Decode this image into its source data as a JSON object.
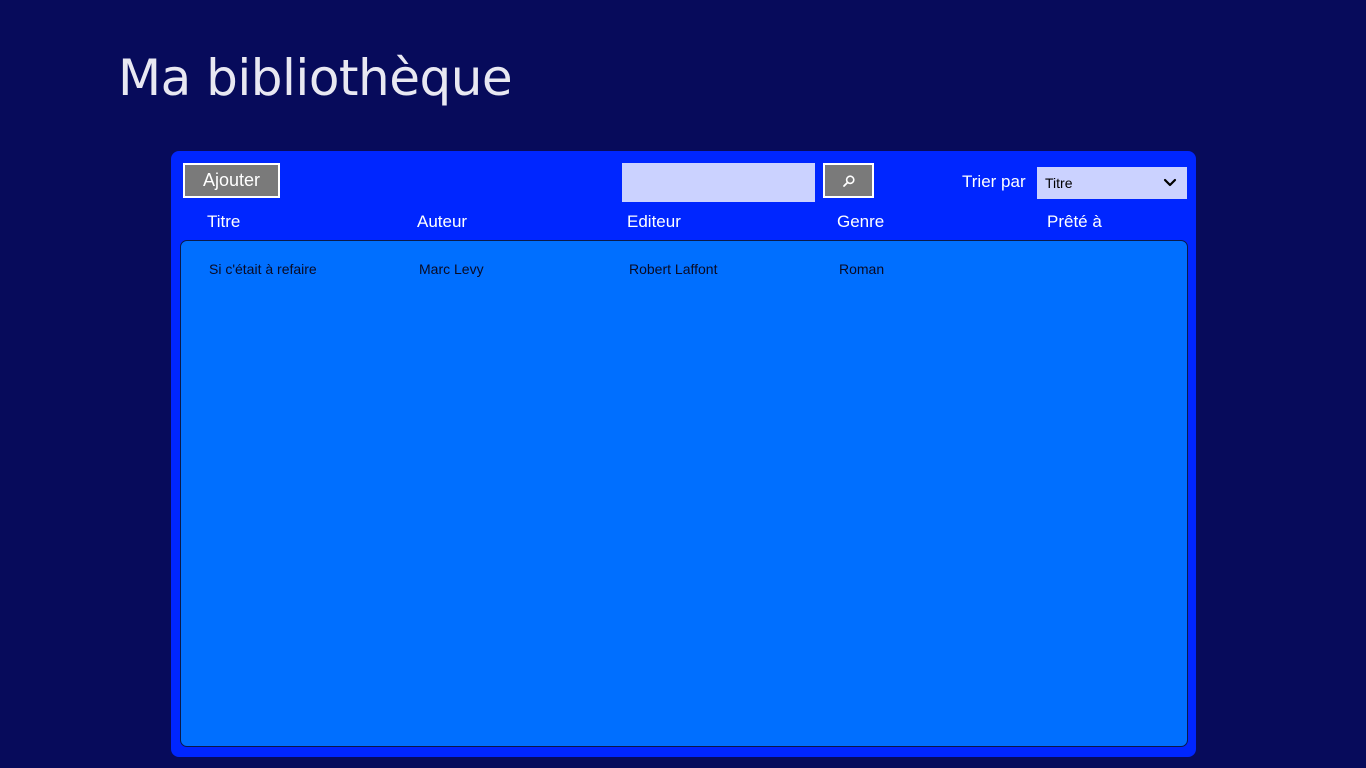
{
  "page": {
    "title": "Ma bibliothèque"
  },
  "toolbar": {
    "add_label": "Ajouter",
    "search": {
      "value": "",
      "placeholder": ""
    },
    "search_icon": "search-icon",
    "sort_label": "Trier par",
    "sort_value": "Titre",
    "sort_icon": "chevron-down-icon"
  },
  "table": {
    "headers": [
      "Titre",
      "Auteur",
      "Editeur",
      "Genre",
      "Prêté à"
    ],
    "rows": [
      [
        "Si c'était à refaire",
        "Marc Levy",
        "Robert Laffont",
        "Roman",
        ""
      ]
    ]
  },
  "colors": {
    "background": "#070b5b",
    "panel": "#0026ff",
    "list": "#006fff",
    "button": "#7a7a7a",
    "input": "#cbd2ff"
  }
}
